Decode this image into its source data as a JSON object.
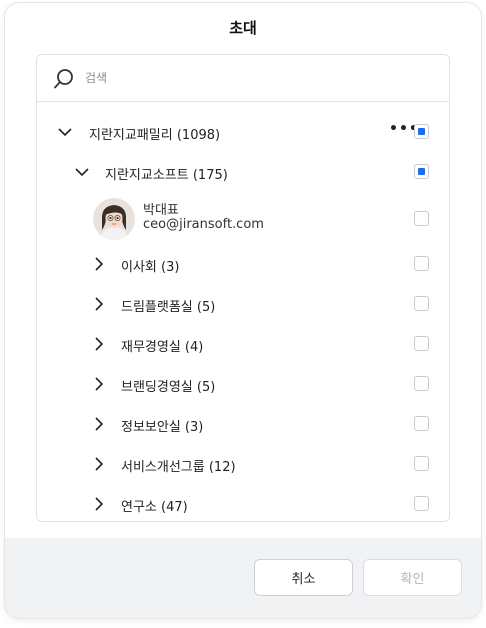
{
  "dialog": {
    "title": "초대"
  },
  "search": {
    "placeholder": "검색",
    "value": ""
  },
  "tree": {
    "root": {
      "label": "지란지교패밀리 (1098)",
      "more_label": "•••"
    },
    "company": {
      "label": "지란지교소프트 (175)"
    },
    "user": {
      "name": "박대표",
      "email": "ceo@jiransoft.com"
    },
    "departments": [
      {
        "label": "이사회 (3)"
      },
      {
        "label": "드림플랫폼실 (5)"
      },
      {
        "label": "재무경영실 (4)"
      },
      {
        "label": "브랜딩경영실 (5)"
      },
      {
        "label": "정보보안실 (3)"
      },
      {
        "label": "서비스개선그룹 (12)"
      },
      {
        "label": "연구소 (47)"
      }
    ]
  },
  "footer": {
    "cancel_label": "취소",
    "confirm_label": "확인"
  },
  "colors": {
    "accent": "#1a6cf0",
    "footer_bg": "#f1f2f4"
  }
}
